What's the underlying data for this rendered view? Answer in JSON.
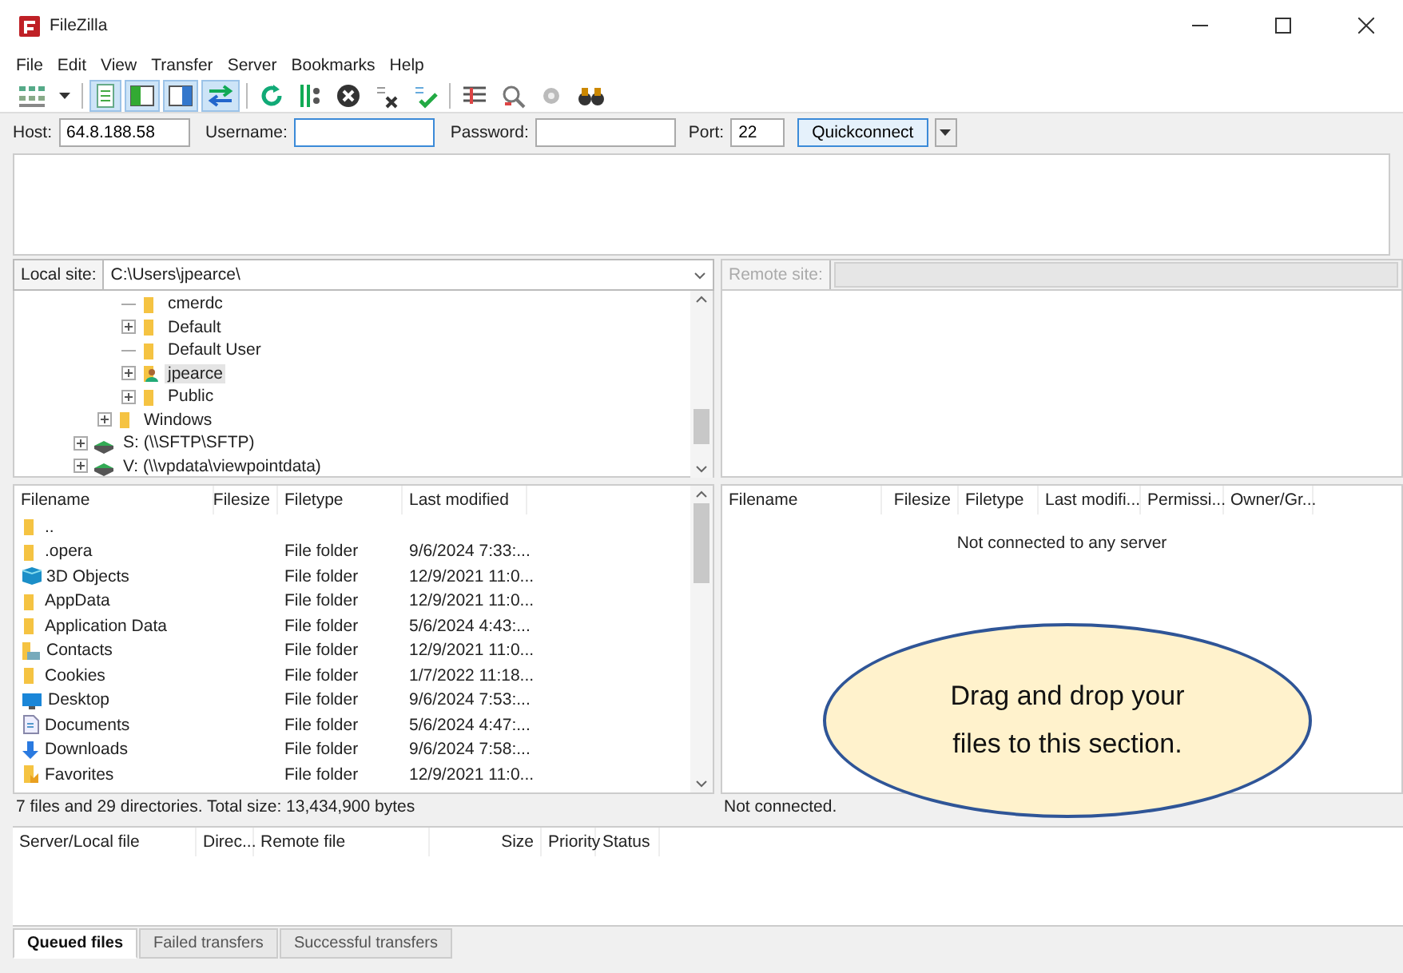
{
  "window": {
    "title": "FileZilla"
  },
  "menu": [
    "File",
    "Edit",
    "View",
    "Transfer",
    "Server",
    "Bookmarks",
    "Help"
  ],
  "toolbar": [
    {
      "kind": "sites",
      "pressed": false
    },
    {
      "kind": "caret",
      "pressed": false
    },
    {
      "kind": "log",
      "pressed": true
    },
    {
      "kind": "left",
      "pressed": true
    },
    {
      "kind": "right",
      "pressed": true
    },
    {
      "kind": "queue",
      "pressed": true
    },
    {
      "kind": "refresh",
      "pressed": false
    },
    {
      "kind": "process",
      "pressed": false
    },
    {
      "kind": "cancel",
      "pressed": false
    },
    {
      "kind": "disconnect",
      "pressed": false
    },
    {
      "kind": "reconnect",
      "pressed": false
    },
    {
      "kind": "filter",
      "pressed": false
    },
    {
      "kind": "compare",
      "pressed": false
    },
    {
      "kind": "sync",
      "pressed": false
    },
    {
      "kind": "find",
      "pressed": false
    }
  ],
  "quickconnect": {
    "host": {
      "label": "Host:",
      "value": "64.8.188.58"
    },
    "username": {
      "label": "Username:",
      "focused": true
    },
    "password": {
      "label": "Password:"
    },
    "port": {
      "label": "Port:",
      "value": "22"
    },
    "button": "Quickconnect"
  },
  "local": {
    "site_label": "Local site:",
    "path": "C:\\Users\\jpearce\\",
    "tree": [
      {
        "children": [
          {
            "children": [
              {
                "label": "cmerdc",
                "kind": "folder",
                "expandable": false,
                "selected": false
              },
              {
                "label": "Default",
                "kind": "folder",
                "expandable": true,
                "selected": false
              },
              {
                "label": "Default User",
                "kind": "folder",
                "expandable": false,
                "selected": false
              },
              {
                "label": "jpearce",
                "kind": "user",
                "expandable": true,
                "selected": true
              },
              {
                "label": "Public",
                "kind": "folder",
                "expandable": true,
                "selected": false
              }
            ]
          },
          {
            "label": "Windows",
            "kind": "folder",
            "expandable": true,
            "selected": false
          }
        ]
      },
      {
        "label": "S: (\\\\SFTP\\SFTP)",
        "kind": "drive",
        "expandable": true,
        "selected": false
      },
      {
        "label": "V: (\\\\vpdata\\viewpointdata)",
        "kind": "drive",
        "expandable": true,
        "selected": false
      }
    ],
    "columns": [
      "Filename",
      "Filesize",
      "Filetype",
      "Last modified"
    ],
    "rows": [
      {
        "kind": "folder",
        "name": "..",
        "type": "",
        "modified": ""
      },
      {
        "kind": "folder",
        "name": ".opera",
        "type": "File folder",
        "modified": "9/6/2024 7:33:..."
      },
      {
        "kind": "cube",
        "name": "3D Objects",
        "type": "File folder",
        "modified": "12/9/2021 11:0..."
      },
      {
        "kind": "folder",
        "name": "AppData",
        "type": "File folder",
        "modified": "12/9/2021 11:0..."
      },
      {
        "kind": "folder",
        "name": "Application Data",
        "type": "File folder",
        "modified": "5/6/2024 4:43:..."
      },
      {
        "kind": "contacts",
        "name": "Contacts",
        "type": "File folder",
        "modified": "12/9/2021 11:0..."
      },
      {
        "kind": "folder",
        "name": "Cookies",
        "type": "File folder",
        "modified": "1/7/2022 11:18..."
      },
      {
        "kind": "desktop",
        "name": "Desktop",
        "type": "File folder",
        "modified": "9/6/2024 7:53:..."
      },
      {
        "kind": "documents",
        "name": "Documents",
        "type": "File folder",
        "modified": "5/6/2024 4:47:..."
      },
      {
        "kind": "downloads",
        "name": "Downloads",
        "type": "File folder",
        "modified": "9/6/2024 7:58:..."
      },
      {
        "kind": "favorites",
        "name": "Favorites",
        "type": "File folder",
        "modified": "12/9/2021 11:0..."
      }
    ],
    "status": "7 files and 29 directories. Total size: 13,434,900 bytes"
  },
  "remote": {
    "site_label": "Remote site:",
    "columns": [
      "Filename",
      "Filesize",
      "Filetype",
      "Last modifi...",
      "Permissi...",
      "Owner/Gr..."
    ],
    "empty_message": "Not connected to any server",
    "status": "Not connected."
  },
  "callout": "Drag and drop your\nfiles to this section.",
  "queue": {
    "columns": [
      "Server/Local file",
      "Direc...",
      "Remote file",
      "Size",
      "Priority",
      "Status"
    ],
    "tabs": [
      {
        "label": "Queued files",
        "selected": true
      },
      {
        "label": "Failed transfers",
        "selected": false
      },
      {
        "label": "Successful transfers",
        "selected": false
      }
    ]
  }
}
